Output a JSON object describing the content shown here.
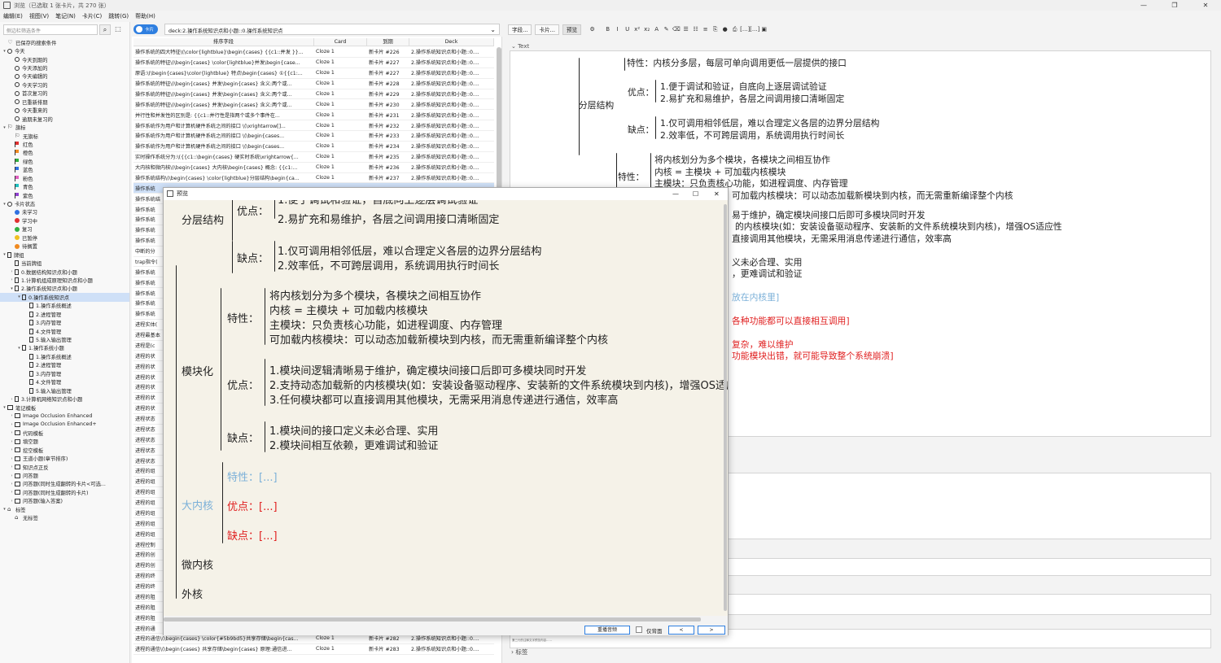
{
  "window": {
    "title": "浏览（已选取 1 张卡片，共 270 张）"
  },
  "menu": [
    "编辑(E)",
    "视图(V)",
    "笔记(N)",
    "卡片(C)",
    "跳转(G)",
    "帮助(H)"
  ],
  "sidebar": {
    "search_placeholder": "侧边栏筛选条件",
    "items": [
      {
        "label": "已保存的搜索条件",
        "icon": "heart",
        "indent": 0,
        "tw": ""
      },
      {
        "label": "今天",
        "icon": "clock",
        "indent": 0,
        "tw": "▾"
      },
      {
        "label": "今天到期的",
        "icon": "clock",
        "indent": 1,
        "tw": ""
      },
      {
        "label": "今天添加的",
        "icon": "clock",
        "indent": 1,
        "tw": ""
      },
      {
        "label": "今天编辑的",
        "icon": "clock",
        "indent": 1,
        "tw": ""
      },
      {
        "label": "今天学习的",
        "icon": "clock",
        "indent": 1,
        "tw": ""
      },
      {
        "label": "首次复习的",
        "icon": "clock",
        "indent": 1,
        "tw": ""
      },
      {
        "label": "已重新排期",
        "icon": "clock",
        "indent": 1,
        "tw": ""
      },
      {
        "label": "今天重来的",
        "icon": "clock",
        "indent": 1,
        "tw": ""
      },
      {
        "label": "逾期未复习的",
        "icon": "clock",
        "indent": 1,
        "tw": ""
      },
      {
        "label": "旗标",
        "icon": "flag",
        "indent": 0,
        "tw": "▾"
      },
      {
        "label": "无旗标",
        "icon": "flag",
        "indent": 1,
        "tw": ""
      },
      {
        "label": "红色",
        "icon": "flag",
        "indent": 1,
        "tw": "",
        "color": "#e03030"
      },
      {
        "label": "橙色",
        "icon": "flag",
        "indent": 1,
        "tw": "",
        "color": "#f08a20"
      },
      {
        "label": "绿色",
        "icon": "flag",
        "indent": 1,
        "tw": "",
        "color": "#30b040"
      },
      {
        "label": "蓝色",
        "icon": "flag",
        "indent": 1,
        "tw": "",
        "color": "#3070e0"
      },
      {
        "label": "粉色",
        "icon": "flag",
        "indent": 1,
        "tw": "",
        "color": "#e060c0"
      },
      {
        "label": "青色",
        "icon": "flag",
        "indent": 1,
        "tw": "",
        "color": "#20c0c0"
      },
      {
        "label": "紫色",
        "icon": "flag",
        "indent": 1,
        "tw": "",
        "color": "#9040d0"
      },
      {
        "label": "卡片状态",
        "icon": "clock",
        "indent": 0,
        "tw": "▾"
      },
      {
        "label": "未学习",
        "icon": "dot",
        "indent": 1,
        "tw": "",
        "color": "#3070e0"
      },
      {
        "label": "学习中",
        "icon": "dot",
        "indent": 1,
        "tw": "",
        "color": "#e03030"
      },
      {
        "label": "复习",
        "icon": "dot",
        "indent": 1,
        "tw": "",
        "color": "#30b040"
      },
      {
        "label": "已暂停",
        "icon": "dot",
        "indent": 1,
        "tw": "",
        "color": "#f0c020"
      },
      {
        "label": "待搁置",
        "icon": "dot",
        "indent": 1,
        "tw": "",
        "color": "#f08a20"
      },
      {
        "label": "牌组",
        "icon": "deck",
        "indent": 0,
        "tw": "▾"
      },
      {
        "label": "当前牌组",
        "icon": "deck",
        "indent": 1,
        "tw": ""
      },
      {
        "label": "0.数据结构知识点和小题",
        "icon": "deck",
        "indent": 1,
        "tw": "›"
      },
      {
        "label": "1.计算机组成原理知识点和小题",
        "icon": "deck",
        "indent": 1,
        "tw": "›"
      },
      {
        "label": "2.操作系统知识点和小题",
        "icon": "deck",
        "indent": 1,
        "tw": "▾"
      },
      {
        "label": "0.操作系统知识点",
        "icon": "deck",
        "indent": 2,
        "tw": "▾",
        "selected": true
      },
      {
        "label": "1.操作系统概述",
        "icon": "deck",
        "indent": 3,
        "tw": ""
      },
      {
        "label": "2.进程管理",
        "icon": "deck",
        "indent": 3,
        "tw": ""
      },
      {
        "label": "3.内存管理",
        "icon": "deck",
        "indent": 3,
        "tw": ""
      },
      {
        "label": "4.文件管理",
        "icon": "deck",
        "indent": 3,
        "tw": ""
      },
      {
        "label": "5.输入输出管理",
        "icon": "deck",
        "indent": 3,
        "tw": ""
      },
      {
        "label": "1.操作系统小题",
        "icon": "deck",
        "indent": 2,
        "tw": "▾"
      },
      {
        "label": "1.操作系统概述",
        "icon": "deck",
        "indent": 3,
        "tw": ""
      },
      {
        "label": "2.进程管理",
        "icon": "deck",
        "indent": 3,
        "tw": ""
      },
      {
        "label": "3.内存管理",
        "icon": "deck",
        "indent": 3,
        "tw": ""
      },
      {
        "label": "4.文件管理",
        "icon": "deck",
        "indent": 3,
        "tw": ""
      },
      {
        "label": "5.输入输出管理",
        "icon": "deck",
        "indent": 3,
        "tw": ""
      },
      {
        "label": "3.计算机网络知识点和小题",
        "icon": "deck",
        "indent": 1,
        "tw": "›"
      },
      {
        "label": "笔记模板",
        "icon": "notetype",
        "indent": 0,
        "tw": "▾"
      },
      {
        "label": "Image Occlusion Enhanced",
        "icon": "notetype",
        "indent": 1,
        "tw": "›"
      },
      {
        "label": "Image Occlusion Enhanced+",
        "icon": "notetype",
        "indent": 1,
        "tw": "›"
      },
      {
        "label": "代码模板",
        "icon": "notetype",
        "indent": 1,
        "tw": "›"
      },
      {
        "label": "填空题",
        "icon": "notetype",
        "indent": 1,
        "tw": "›"
      },
      {
        "label": "挖空模板",
        "icon": "notetype",
        "indent": 1,
        "tw": "›"
      },
      {
        "label": "王道小题(章节排序)",
        "icon": "notetype",
        "indent": 1,
        "tw": "›"
      },
      {
        "label": "知识点正反",
        "icon": "notetype",
        "indent": 1,
        "tw": "›"
      },
      {
        "label": "问答题",
        "icon": "notetype",
        "indent": 1,
        "tw": "›"
      },
      {
        "label": "问答题(同时生成翻转的卡片<可选...",
        "icon": "notetype",
        "indent": 1,
        "tw": "›"
      },
      {
        "label": "问答题(同时生成翻转的卡片)",
        "icon": "notetype",
        "indent": 1,
        "tw": "›"
      },
      {
        "label": "问答题(输入答案)",
        "icon": "notetype",
        "indent": 1,
        "tw": "›"
      },
      {
        "label": "标签",
        "icon": "tag",
        "indent": 0,
        "tw": "▾"
      },
      {
        "label": "无标签",
        "icon": "tag",
        "indent": 1,
        "tw": ""
      }
    ]
  },
  "cardlist": {
    "toggle_label": "卡片",
    "filter": "deck:2.操作系统知识点和小题::0.操作系统知识点",
    "columns": [
      "排序字段",
      "Card",
      "到期",
      "Deck"
    ],
    "rows": [
      [
        "操作系统的四大特征\\(\\color{lightblue}\\begin{cases} {{c1::并发 }}...",
        "Cloze 1",
        "新卡片 #226",
        "2.操作系统知识点和小题::0...."
      ],
      [
        "操作系统的特征\\(\\begin{cases} \\color{lightblue}并发\\begin{case...",
        "Cloze 1",
        "新卡片 #227",
        "2.操作系统知识点和小题::0...."
      ],
      [
        "原语:\\(\\begin{cases}\\color{lightblue} 特点\\begin{cases} ①{{c1:...",
        "Cloze 1",
        "新卡片 #227",
        "2.操作系统知识点和小题::0...."
      ],
      [
        "操作系统的特征\\(\\begin{cases} 并发\\begin{cases} 含义:两个或...",
        "Cloze 1",
        "新卡片 #228",
        "2.操作系统知识点和小题::0...."
      ],
      [
        "操作系统的特征\\(\\begin{cases} 并发\\begin{cases} 含义:两个或...",
        "Cloze 1",
        "新卡片 #229",
        "2.操作系统知识点和小题::0...."
      ],
      [
        "操作系统的特征\\(\\begin{cases} 并发\\begin{cases} 含义:两个或...",
        "Cloze 1",
        "新卡片 #230",
        "2.操作系统知识点和小题::0...."
      ],
      [
        "并行性和并发性的区别是: {{c1::并行性是指两个或多个事件在...",
        "Cloze 1",
        "新卡片 #231",
        "2.操作系统知识点和小题::0...."
      ],
      [
        "操作系统作为用户和计算机硬件系统之间的接口 \\(\\xrightarrow[]...",
        "Cloze 1",
        "新卡片 #232",
        "2.操作系统知识点和小题::0...."
      ],
      [
        "操作系统作为用户和计算机硬件系统之间的接口 \\(\\begin{cases...",
        "Cloze 1",
        "新卡片 #233",
        "2.操作系统知识点和小题::0...."
      ],
      [
        "操作系统作为用户和计算机硬件系统之间的接口 \\(\\begin{cases...",
        "Cloze 1",
        "新卡片 #234",
        "2.操作系统知识点和小题::0...."
      ],
      [
        "实时操作系统分为:\\({{c1::\\begin{cases} 硬实时系统\\xrightarrow{...",
        "Cloze 1",
        "新卡片 #235",
        "2.操作系统知识点和小题::0...."
      ],
      [
        "大内核和微内核\\(\\begin{cases} 大内核\\begin{cases} 概念: {{c1:...",
        "Cloze 1",
        "新卡片 #236",
        "2.操作系统知识点和小题::0...."
      ],
      [
        "操作系统结构\\(\\begin{cases} \\color{lightblue}分层结构\\begin{ca...",
        "Cloze 1",
        "新卡片 #237",
        "2.操作系统知识点和小题::0...."
      ],
      [
        "操作系统",
        "",
        "",
        ""
      ],
      [
        "操作系统结",
        "",
        "",
        ""
      ],
      [
        "操作系统",
        "",
        "",
        ""
      ],
      [
        "操作系统",
        "",
        "",
        ""
      ],
      [
        "操作系统",
        "",
        "",
        ""
      ],
      [
        "操作系统",
        "",
        "",
        ""
      ],
      [
        "中断的分",
        "",
        "",
        ""
      ],
      [
        "trap指令(",
        "",
        "",
        ""
      ],
      [
        "操作系统",
        "",
        "",
        ""
      ],
      [
        "操作系统",
        "",
        "",
        ""
      ],
      [
        "操作系统",
        "",
        "",
        ""
      ],
      [
        "操作系统",
        "",
        "",
        ""
      ],
      [
        "操作系统",
        "",
        "",
        ""
      ],
      [
        "进程实体(",
        "",
        "",
        ""
      ],
      [
        "进程最基本",
        "",
        "",
        ""
      ],
      [
        "进程是(c",
        "",
        "",
        ""
      ],
      [
        "进程的状",
        "",
        "",
        ""
      ],
      [
        "进程的状",
        "",
        "",
        ""
      ],
      [
        "进程的状",
        "",
        "",
        ""
      ],
      [
        "进程的状",
        "",
        "",
        ""
      ],
      [
        "进程的状",
        "",
        "",
        ""
      ],
      [
        "进程的状",
        "",
        "",
        ""
      ],
      [
        "进程状态",
        "",
        "",
        ""
      ],
      [
        "进程状态",
        "",
        "",
        ""
      ],
      [
        "进程状态",
        "",
        "",
        ""
      ],
      [
        "进程状态",
        "",
        "",
        ""
      ],
      [
        "进程状态",
        "",
        "",
        ""
      ],
      [
        "进程的组",
        "",
        "",
        ""
      ],
      [
        "进程的组",
        "",
        "",
        ""
      ],
      [
        "进程的组",
        "",
        "",
        ""
      ],
      [
        "进程的组",
        "",
        "",
        ""
      ],
      [
        "进程的组",
        "",
        "",
        ""
      ],
      [
        "进程的组",
        "",
        "",
        ""
      ],
      [
        "进程的组",
        "",
        "",
        ""
      ],
      [
        "进程控制",
        "",
        "",
        ""
      ],
      [
        "进程的创",
        "",
        "",
        ""
      ],
      [
        "进程的创",
        "",
        "",
        ""
      ],
      [
        "进程的终",
        "",
        "",
        ""
      ],
      [
        "进程的终",
        "",
        "",
        ""
      ],
      [
        "进程的阻",
        "",
        "",
        ""
      ],
      [
        "进程的阻",
        "",
        "",
        ""
      ],
      [
        "进程的阻",
        "",
        "",
        ""
      ],
      [
        "进程的通",
        "",
        "",
        ""
      ],
      [
        "进程的通信\\(\\begin{cases} \\color{#5b9bd5}共享存储\\begin{cas...",
        "Cloze 1",
        "新卡片 #282",
        "2.操作系统知识点和小题::0...."
      ],
      [
        "进程的通信\\(\\begin{cases} 共享存储\\begin{cases} 原理:通信进...",
        "Cloze 1",
        "新卡片 #283",
        "2.操作系统知识点和小题::0...."
      ]
    ],
    "selected_row": 13
  },
  "editor": {
    "buttons": [
      "字段...",
      "卡片...",
      "预览"
    ],
    "format_icons": [
      "B",
      "I",
      "U",
      "x²",
      "x₂",
      "A",
      "✎",
      "⌫",
      "☰",
      "☷",
      "≡",
      "⎘",
      "●",
      "⎙",
      "[...]",
      "[...]",
      "▣"
    ],
    "field_label": "Text",
    "tags_label": "标签",
    "note_lines": [
      "第二行的注释文字预览内容……",
      "第三行的注释文字预览内容……"
    ]
  },
  "content": {
    "layered": "分层结构",
    "feature_label": "特性：",
    "layered_feature": "内核分多层，每层可单向调用更低一层提供的接口",
    "pros": "优点：",
    "cons": "缺点：",
    "layered_pro1": "1.便于调试和验证，自底向上逐层调试验证",
    "layered_pro2": "2.易扩充和易维护，各层之间调用接口清晰固定",
    "layered_con1": "1.仅可调用相邻低层，难以合理定义各层的边界分层结构",
    "layered_con2": "2.效率低，不可跨层调用，系统调用执行时间长",
    "modular": "模块化",
    "mod_f1": "将内核划分为多个模块，各模块之间相互协作",
    "mod_f2": "内核 = 主模块 + 可加载内核模块",
    "mod_f3": "主模块：只负责核心功能，如进程调度、内存管理",
    "mod_f4": "可加载内核模块：可以动态加载新模块到内核，而无需重新编译整个内核",
    "mod_p1": "1.模块间逻辑清晰易于维护，确定模块间接口后即可多模块同时开发",
    "mod_p2": "2.支持动态加载新的内核模块(如：安装设备驱动程序、安装新的文件系统模块到内核)，增强OS适应性",
    "mod_p3": "3.任何模块都可以直接调用其他模块，无需采用消息传递进行通信，效率高",
    "mod_c1": "1.模块间的接口定义未必合理、实用",
    "mod_c2": "2.模块间相互依赖，更难调试和验证",
    "macro": "大内核",
    "cloze": "[...]",
    "micro": "微内核",
    "exo": "外核",
    "ed_mod_p1_tail": "易于维护，确定模块间接口后即可多模块同时开发",
    "ed_mod_p2_tail": "的内核模块(如：安装设备驱动程序、安装新的文件系统模块到内核)，增强OS适应性",
    "ed_mod_p3_tail": "直接调用其他模块，无需采用消息传递进行通信，效率高",
    "ed_mod_c1_tail": "义未必合理、实用",
    "ed_mod_c2_tail": "，更难调试和验证",
    "ed_blue_tail": "放在内核里]",
    "ed_red1_tail": "各种功能都可以直接相互调用]",
    "ed_red2_tail": "复杂，难以维护",
    "ed_red3_tail": "功能模块出错，就可能导致整个系统崩溃]"
  },
  "preview": {
    "title": "预览",
    "replay": "重播音频",
    "back_only": "仅背面",
    "prev": "<",
    "next": ">"
  }
}
